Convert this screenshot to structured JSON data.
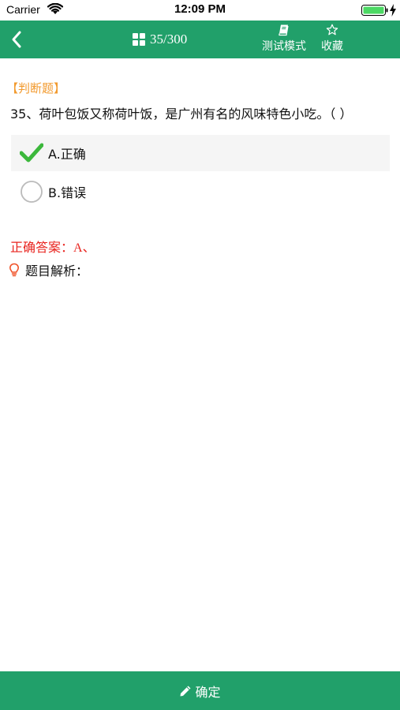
{
  "status_bar": {
    "carrier": "Carrier",
    "time": "12:09 PM"
  },
  "nav": {
    "progress": "35/300",
    "test_mode_label": "测试模式",
    "favorite_label": "收藏"
  },
  "question": {
    "type_label": "【判断题】",
    "text": "35、荷叶包饭又称荷叶饭，是广州有名的风味特色小吃。（ ）",
    "options": [
      {
        "label": "A.正确",
        "selected": true
      },
      {
        "label": "B.错误",
        "selected": false
      }
    ]
  },
  "answer": {
    "label": "正确答案：",
    "value": "A、"
  },
  "analysis": {
    "label": "题目解析："
  },
  "confirm_label": "确定",
  "colors": {
    "primary": "#21a06a",
    "type_orange": "#f29a2e",
    "answer_red": "#e8231e",
    "check_green": "#3cb83c"
  }
}
